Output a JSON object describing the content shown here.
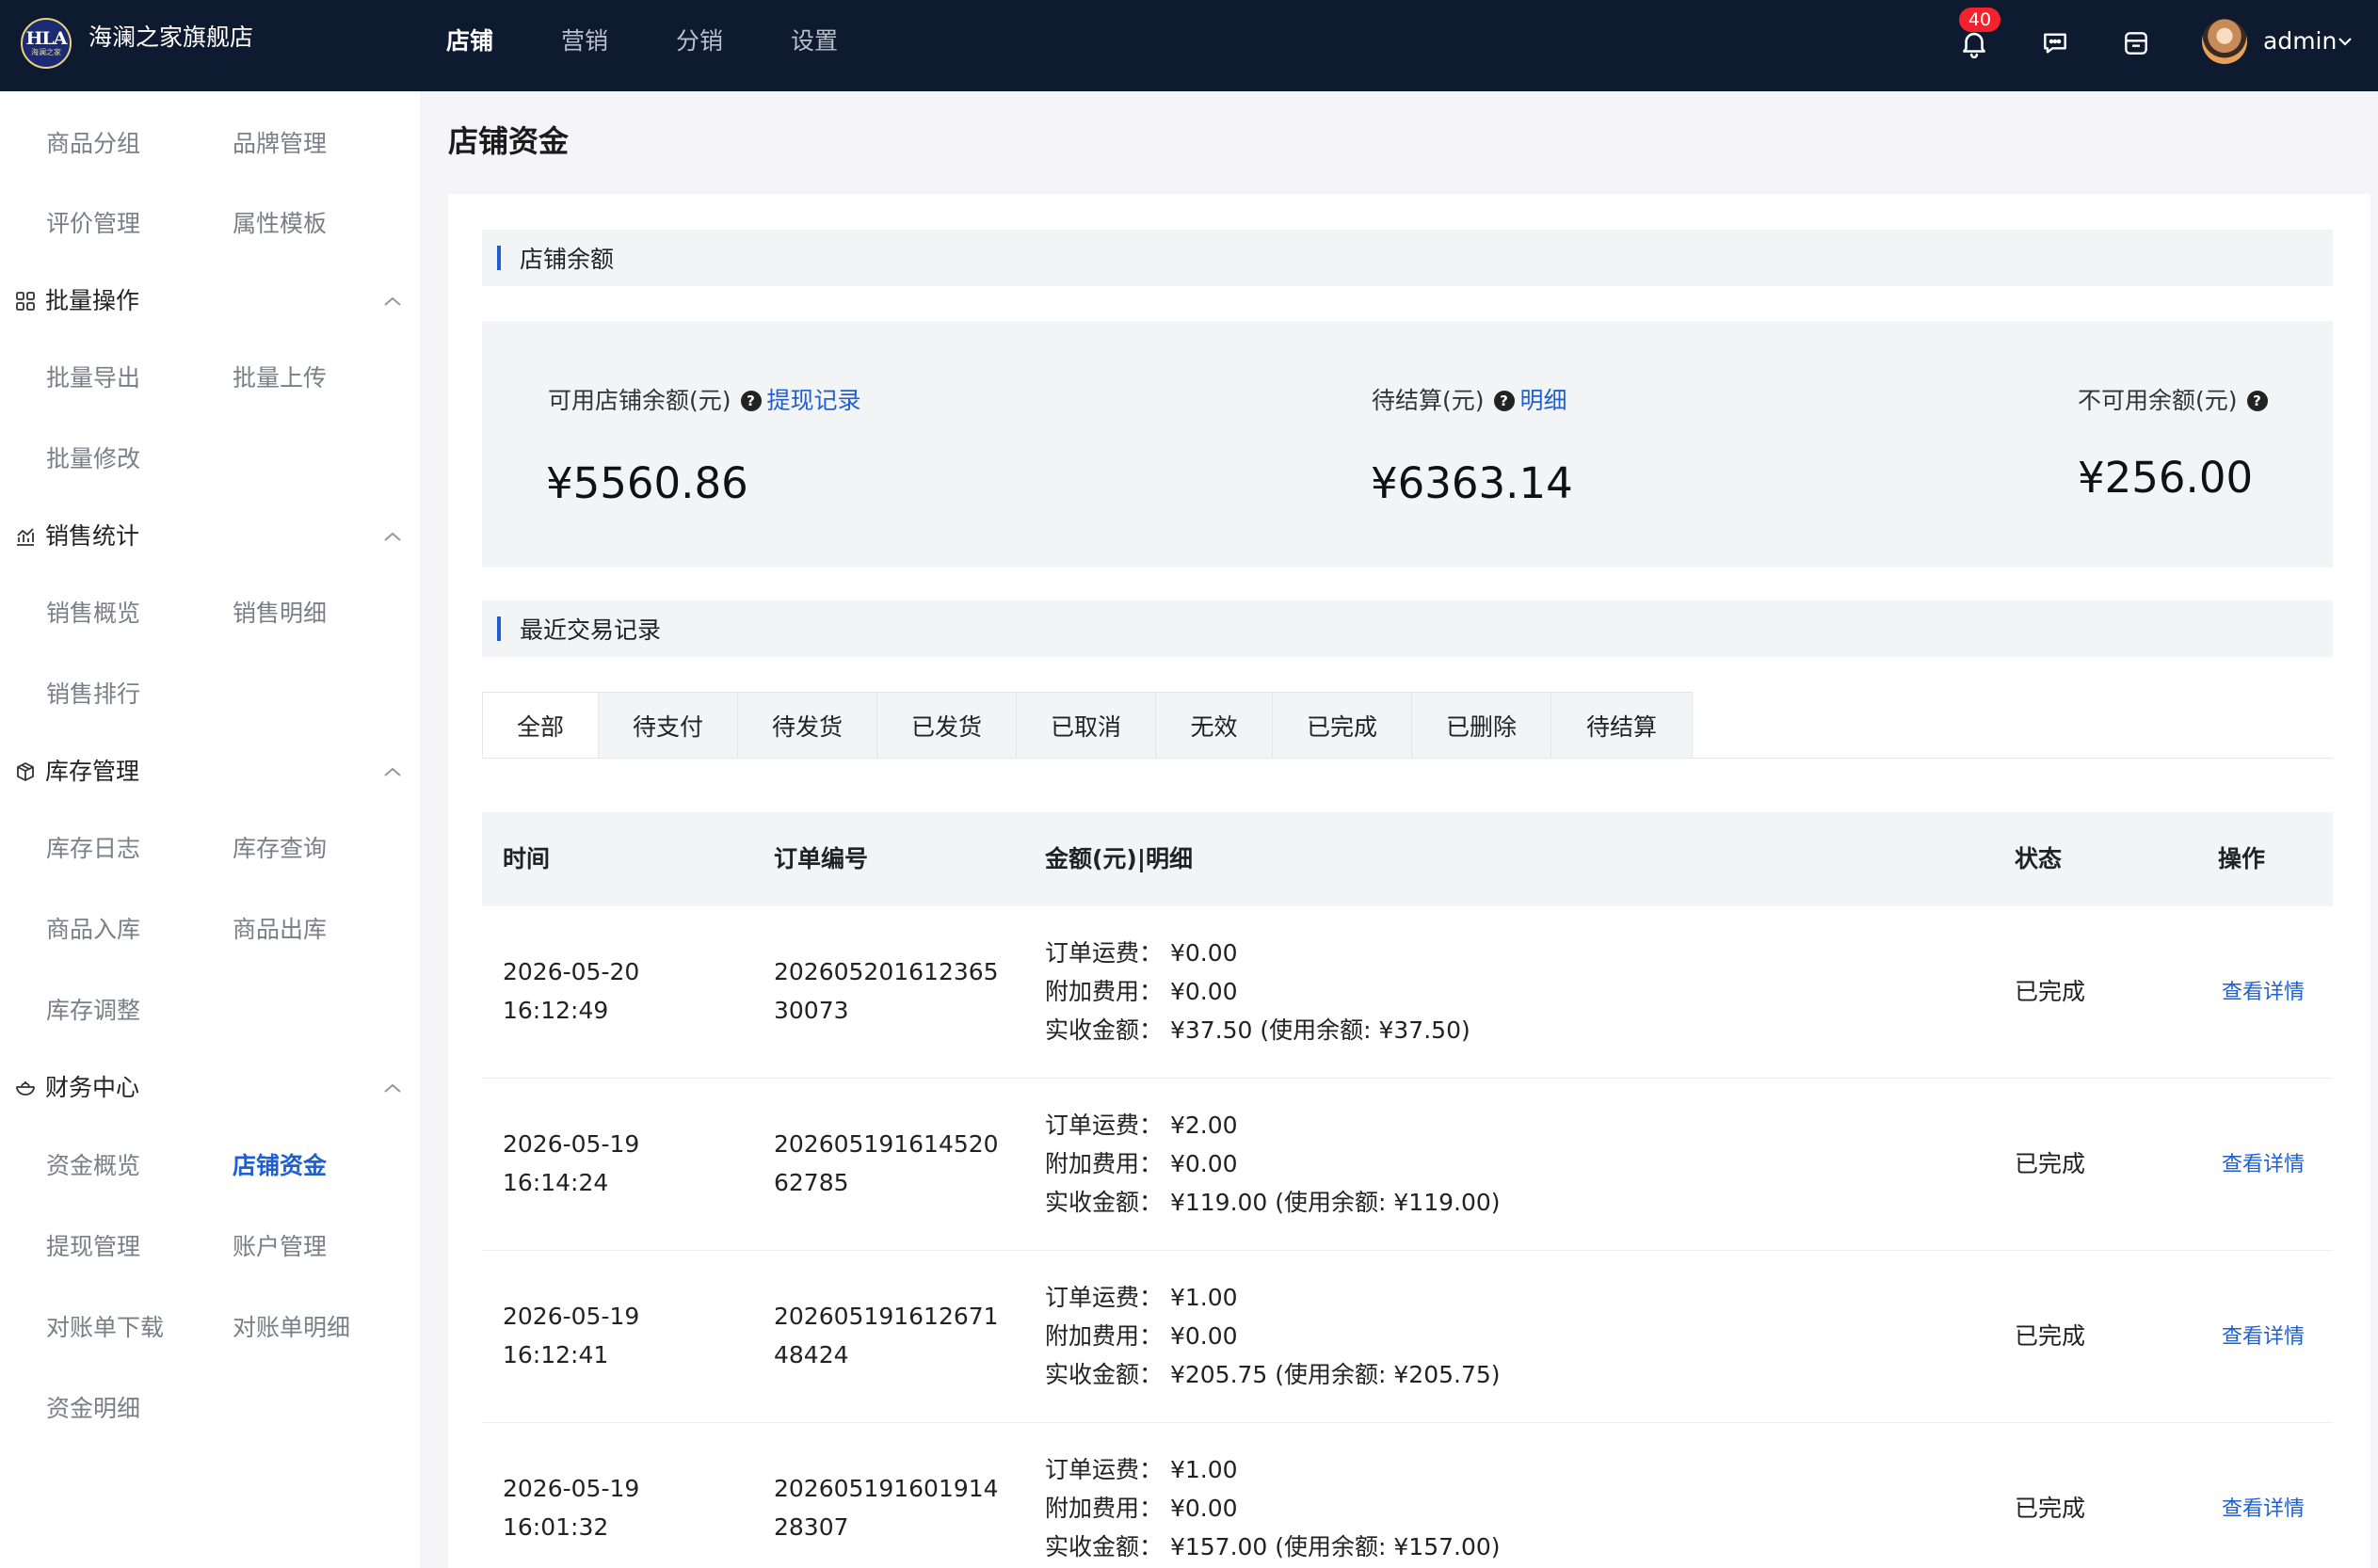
{
  "header": {
    "logo_text": "HLA",
    "logo_sub": "海澜之家",
    "store_name": "海澜之家旗舰店",
    "nav": [
      "店铺",
      "营销",
      "分销",
      "设置"
    ],
    "active_nav": 0,
    "notification_count": "40",
    "user": "admin"
  },
  "sidebar": {
    "top_items": [
      "商品分组",
      "品牌管理",
      "评价管理",
      "属性模板"
    ],
    "groups": [
      {
        "title": "批量操作",
        "icon": "grid-icon",
        "items": [
          "批量导出",
          "批量上传",
          "批量修改"
        ]
      },
      {
        "title": "销售统计",
        "icon": "chart-icon",
        "items": [
          "销售概览",
          "销售明细",
          "销售排行"
        ]
      },
      {
        "title": "库存管理",
        "icon": "box-icon",
        "items": [
          "库存日志",
          "库存查询",
          "商品入库",
          "商品出库",
          "库存调整"
        ]
      },
      {
        "title": "财务中心",
        "icon": "money-bowl-icon",
        "items": [
          "资金概览",
          "店铺资金",
          "提现管理",
          "账户管理",
          "对账单下载",
          "对账单明细",
          "资金明细"
        ]
      }
    ],
    "active_item": "店铺资金"
  },
  "page": {
    "title": "店铺资金",
    "balance_section": "店铺余额",
    "balances": [
      {
        "label": "可用店铺余额(元)",
        "link": "提现记录",
        "value": "¥5560.86"
      },
      {
        "label": "待结算(元)",
        "link": "明细",
        "value": "¥6363.14"
      },
      {
        "label": "不可用余额(元)",
        "link": "",
        "value": "¥256.00"
      }
    ],
    "records_section": "最近交易记录",
    "tabs": [
      "全部",
      "待支付",
      "待发货",
      "已发货",
      "已取消",
      "无效",
      "已完成",
      "已删除",
      "待结算"
    ],
    "active_tab": 0,
    "columns": [
      "时间",
      "订单编号",
      "金额(元)|明细",
      "状态",
      "操作"
    ],
    "rows": [
      {
        "date": "2026-05-20",
        "time": "16:12:49",
        "order_1": "202605201612365",
        "order_2": "30073",
        "shipping": "订单运费：  ¥0.00",
        "extra": "附加费用：  ¥0.00",
        "received": "实收金额：  ¥37.50 (使用余额: ¥37.50)",
        "status": "已完成",
        "action": "查看详情"
      },
      {
        "date": "2026-05-19",
        "time": "16:14:24",
        "order_1": "202605191614520",
        "order_2": "62785",
        "shipping": "订单运费：  ¥2.00",
        "extra": "附加费用：  ¥0.00",
        "received": "实收金额：  ¥119.00 (使用余额: ¥119.00)",
        "status": "已完成",
        "action": "查看详情"
      },
      {
        "date": "2026-05-19",
        "time": "16:12:41",
        "order_1": "202605191612671",
        "order_2": "48424",
        "shipping": "订单运费：  ¥1.00",
        "extra": "附加费用：  ¥0.00",
        "received": "实收金额：  ¥205.75 (使用余额: ¥205.75)",
        "status": "已完成",
        "action": "查看详情"
      },
      {
        "date": "2026-05-19",
        "time": "16:01:32",
        "order_1": "202605191601914",
        "order_2": "28307",
        "shipping": "订单运费：  ¥1.00",
        "extra": "附加费用：  ¥0.00",
        "received": "实收金额：  ¥157.00 (使用余额: ¥157.00)",
        "status": "已完成",
        "action": "查看详情"
      }
    ]
  },
  "colors": {
    "topbar": "#0d1a2f",
    "accent": "#1f5fd1",
    "badge": "#f5222d"
  }
}
